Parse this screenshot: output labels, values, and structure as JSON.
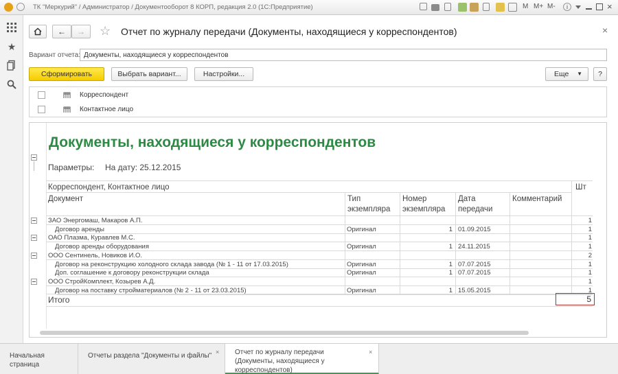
{
  "window": {
    "title": "ТК \"Меркурий\" / Администратор / Документооборот 8 КОРП, редакция 2.0  (1С:Предприятие)",
    "tool_buttons": [
      "M",
      "M+",
      "M-"
    ]
  },
  "form": {
    "title": "Отчет по журналу передачи (Документы, находящиеся у корреспондентов)",
    "close": "×"
  },
  "variant": {
    "label": "Вариант отчета:",
    "value": "Документы, находящиеся у корреспондентов"
  },
  "toolbar": {
    "generate": "Сформировать",
    "choose_variant": "Выбрать вариант...",
    "settings": "Настройки...",
    "more": "Еще",
    "help": "?"
  },
  "groupings": [
    {
      "label": "Корреспондент"
    },
    {
      "label": "Контактное лицо"
    }
  ],
  "report": {
    "title": "Документы, находящиеся у корреспондентов",
    "params_label": "Параметры:",
    "params_value": "На дату: 25.12.2015",
    "header": {
      "group_col": "Корреспондент, Контактное лицо",
      "doc_col": "Документ",
      "type_col": "Тип экземпляра",
      "num_col": "Номер экземпляра",
      "date_col": "Дата передачи",
      "comment_col": "Комментарий",
      "qty_col": "Шт"
    },
    "rows": [
      {
        "text": "ЗАО Энергомаш, Макаров А.П.",
        "type": "",
        "num": "",
        "date": "",
        "qty": "1",
        "group": true
      },
      {
        "text": "Договор аренды",
        "type": "Оригинал",
        "num": "1",
        "date": "01.09.2015",
        "qty": "1",
        "group": false
      },
      {
        "text": "ОАО Плазма, Куравлев М.С.",
        "type": "",
        "num": "",
        "date": "",
        "qty": "1",
        "group": true
      },
      {
        "text": "Договор аренды оборудования",
        "type": "Оригинал",
        "num": "1",
        "date": "24.11.2015",
        "qty": "1",
        "group": false
      },
      {
        "text": "ООО Сентинель, Новиков И.О.",
        "type": "",
        "num": "",
        "date": "",
        "qty": "2",
        "group": true
      },
      {
        "text": "Договор на реконструкцию холодного склада завода (№ 1 - 11 от 17.03.2015)",
        "type": "Оригинал",
        "num": "1",
        "date": "07.07.2015",
        "qty": "1",
        "group": false
      },
      {
        "text": "Доп. соглашение к договору реконструкции склада",
        "type": "Оригинал",
        "num": "1",
        "date": "07.07.2015",
        "qty": "1",
        "group": false
      },
      {
        "text": "ООО СтройКомплект, Козырев А.Д.",
        "type": "",
        "num": "",
        "date": "",
        "qty": "1",
        "group": true
      },
      {
        "text": "Договор на поставку стройматериалов (№ 2 - 11 от 23.03.2015)",
        "type": "Оригинал",
        "num": "1",
        "date": "15.05.2015",
        "qty": "1",
        "group": false
      }
    ],
    "total_label": "Итого",
    "total_value": "5"
  },
  "tabs": [
    {
      "label": "Начальная страница"
    },
    {
      "label": "Отчеты раздела \"Документы и файлы\""
    },
    {
      "label": "Отчет по журналу передачи (Документы, находящиеся у корреспондентов)"
    }
  ],
  "colors": {
    "accent_green": "#2c8a43",
    "primary_button": "#f6cc00",
    "total_border": "#b0302b"
  }
}
